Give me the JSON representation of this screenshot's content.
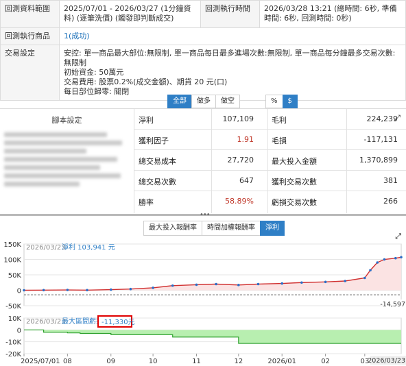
{
  "info": {
    "range_label": "回測資料範圍",
    "range_value": "2025/07/01 - 2026/03/27 (1分鐘資料) (逐筆洗價) (觸發即判斷成交)",
    "exec_time_label": "回測執行時間",
    "exec_time_value": "2026/03/28 13:21 (總時間: 6秒, 準備時間: 6秒, 回測時間: 0秒)",
    "product_label": "回測執行商品",
    "product_value": "1(成功)",
    "trade_label": "交易設定",
    "trade_lines": [
      "安控: 單一商品最大部位:無限制, 單一商品每日最多進場次數:無限制, 單一商品每分鐘最多交易次數:無限制",
      "初始資金: 50萬元",
      "交易費用: 股票0.2%(成交金額)、期貨 20 元(口)",
      "每日部位歸零: 關閉"
    ]
  },
  "filter_buttons": [
    "全部",
    "做多",
    "做空"
  ],
  "unit_buttons": [
    "%",
    "$"
  ],
  "script_label": "腳本設定",
  "stats": [
    {
      "k1": "淨利",
      "v1": "107,109",
      "k2": "毛利",
      "v2": "224,239"
    },
    {
      "k1": "獲利因子",
      "v1": "1.91",
      "k2": "毛損",
      "v2": "-117,131"
    },
    {
      "k1": "總交易成本",
      "v1": "27,720",
      "k2": "最大投入金額",
      "v2": "1,370,899"
    },
    {
      "k1": "總交易次數",
      "v1": "647",
      "k2": "獲利交易次數",
      "v2": "381"
    },
    {
      "k1": "勝率",
      "v1": "58.89%",
      "k2": "虧損交易次數",
      "v2": "266"
    }
  ],
  "chart_tabs": [
    "最大投入報酬率",
    "時間加權報酬率",
    "淨利"
  ],
  "colors": {
    "accent": "#2f7fc6",
    "loss": "#c0392b",
    "profit_line": "#d03030",
    "dd_fill": "#b8efb0",
    "dd_line": "#2ca02c",
    "highlight": "#e00000"
  },
  "chart_data": [
    {
      "type": "line",
      "title": "淨利",
      "date_label": "2026/03/23",
      "value_label": "103,941 元",
      "last_low_label": "-14,597",
      "y_ticks": [
        "150K",
        "100K",
        "50K",
        "0",
        "-50K"
      ],
      "ylim": [
        -50000,
        150000
      ],
      "x_ticks": [
        "2025/07/01",
        "08",
        "09",
        "10",
        "11",
        "12",
        "2026/01",
        "02",
        "03",
        "2026/03/23"
      ],
      "series": [
        {
          "x": [
            "2025/07/01",
            "2025/07/15",
            "2025/08/01",
            "2025/08/15",
            "2025/09/01",
            "2025/09/15",
            "2025/10/01",
            "2025/10/15",
            "2025/11/01",
            "2025/11/15",
            "2025/12/01",
            "2025/12/15",
            "2026/01/01",
            "2026/01/15",
            "2026/02/01",
            "2026/02/15",
            "2026/03/01",
            "2026/03/05",
            "2026/03/10",
            "2026/03/15",
            "2026/03/23",
            "2026/03/27"
          ],
          "values": [
            0,
            500,
            1000,
            500,
            2000,
            4000,
            8000,
            15000,
            18000,
            20000,
            17000,
            20000,
            22000,
            25000,
            27000,
            30000,
            40000,
            65000,
            90000,
            100000,
            103941,
            107109
          ]
        }
      ]
    },
    {
      "type": "area",
      "title": "最大區間虧損",
      "date_label": "2026/03/23",
      "value_label": "-11,330元",
      "y_ticks": [
        "10K",
        "0",
        "-10K",
        "-20K"
      ],
      "ylim": [
        -20000,
        10000
      ],
      "series": [
        {
          "x": [
            "2025/07/01",
            "2025/07/15",
            "2025/08/01",
            "2025/08/10",
            "2025/09/01",
            "2025/10/01",
            "2025/10/15",
            "2025/11/15",
            "2025/12/01",
            "2026/01/01",
            "2026/03/01",
            "2026/03/27"
          ],
          "values": [
            0,
            -2000,
            -2500,
            -3000,
            -4000,
            -4000,
            -6000,
            -6000,
            -11330,
            -11330,
            -11330,
            -11330
          ]
        }
      ]
    }
  ]
}
